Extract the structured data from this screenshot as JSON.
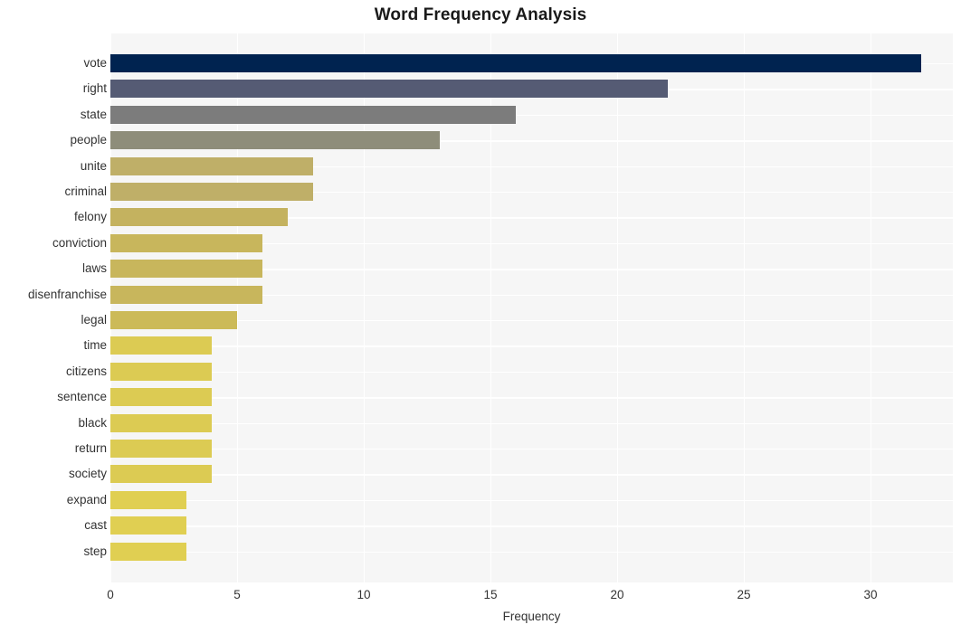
{
  "chart_data": {
    "type": "bar",
    "orientation": "horizontal",
    "title": "Word Frequency Analysis",
    "xlabel": "Frequency",
    "ylabel": "",
    "categories": [
      "vote",
      "right",
      "state",
      "people",
      "unite",
      "criminal",
      "felony",
      "conviction",
      "laws",
      "disenfranchise",
      "legal",
      "time",
      "citizens",
      "sentence",
      "black",
      "return",
      "society",
      "expand",
      "cast",
      "step"
    ],
    "values": [
      32,
      22,
      16,
      13,
      8,
      8,
      7,
      6,
      6,
      6,
      5,
      4,
      4,
      4,
      4,
      4,
      4,
      3,
      3,
      3
    ],
    "bar_colors": [
      "#002350",
      "#555b74",
      "#7c7c7c",
      "#8e8d7a",
      "#bfaf68",
      "#bfaf68",
      "#c4b25f",
      "#c8b65c",
      "#c8b65c",
      "#c8b65c",
      "#ccba58",
      "#dccb53",
      "#dccb53",
      "#dccb53",
      "#dccb53",
      "#dccb53",
      "#dccb53",
      "#e0cf52",
      "#e0cf52",
      "#e0cf52"
    ],
    "xlim": [
      0,
      33.25
    ],
    "xticks": [
      0,
      5,
      10,
      15,
      20,
      25,
      30
    ],
    "xtick_labels": [
      "0",
      "5",
      "10",
      "15",
      "20",
      "25",
      "30"
    ],
    "grid": true,
    "grid_color": "#ffffff",
    "plot_background": "#f6f6f6",
    "figure_background": "#ffffff",
    "legend": null
  }
}
